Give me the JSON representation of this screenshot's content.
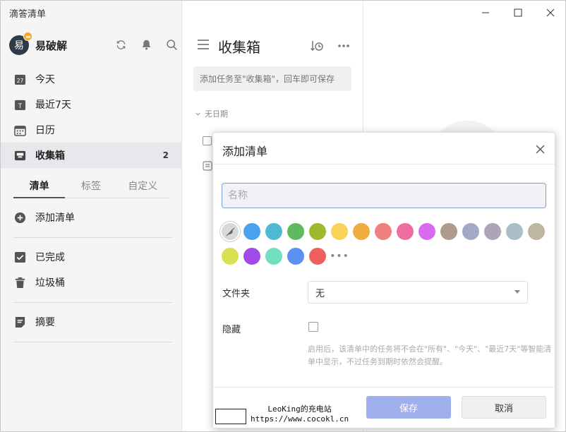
{
  "window": {
    "title": "滴答清单"
  },
  "user": {
    "avatar_char": "易",
    "name": "易破解"
  },
  "nav": [
    {
      "label": "今天",
      "icon": "calendar-27-icon",
      "badge": "27"
    },
    {
      "label": "最近7天",
      "icon": "calendar-t-icon",
      "badge": "T"
    },
    {
      "label": "日历",
      "icon": "calendar-grid-icon"
    },
    {
      "label": "收集箱",
      "icon": "inbox-icon",
      "count": "2",
      "active": true
    }
  ],
  "tabs": [
    "清单",
    "标签",
    "自定义"
  ],
  "add_list_label": "添加清单",
  "nav2": [
    {
      "label": "已完成",
      "icon": "check-box-icon"
    },
    {
      "label": "垃圾桶",
      "icon": "trash-icon"
    }
  ],
  "nav3": [
    {
      "label": "摘要",
      "icon": "summary-icon"
    }
  ],
  "middle": {
    "title": "收集箱",
    "task_placeholder": "添加任务至\"收集箱\"，回车即可保存",
    "section_label": "无日期"
  },
  "modal": {
    "title": "添加清单",
    "name_placeholder": "名称",
    "colors_row1": [
      "none",
      "#4ba3f0",
      "#4fb9d3",
      "#5fba5f",
      "#9dba2f",
      "#f7d358",
      "#f0ac40",
      "#f08080",
      "#ef6da0",
      "#d86af0",
      "#b09a8e",
      "#a2a9c4",
      "#ada4b8",
      "#a9bdc6",
      "#bfb6a0"
    ],
    "colors_row2": [
      "#d9e052",
      "#a04ae8",
      "#71e0c0",
      "#5b8ff0",
      "#ee6060"
    ],
    "folder_label": "文件夹",
    "folder_value": "无",
    "hide_label": "隐藏",
    "hint": "启用后，该清单中的任务将不会在\"所有\"、\"今天\"、\"最近7天\"等智能清单中显示，不过任务到期时依然会提醒。",
    "save_label": "保存",
    "cancel_label": "取消",
    "save_color": "#9fb0ec"
  },
  "watermark": {
    "line1": "LeoKing的充电站",
    "line2": "https://www.cocokl.cn"
  }
}
